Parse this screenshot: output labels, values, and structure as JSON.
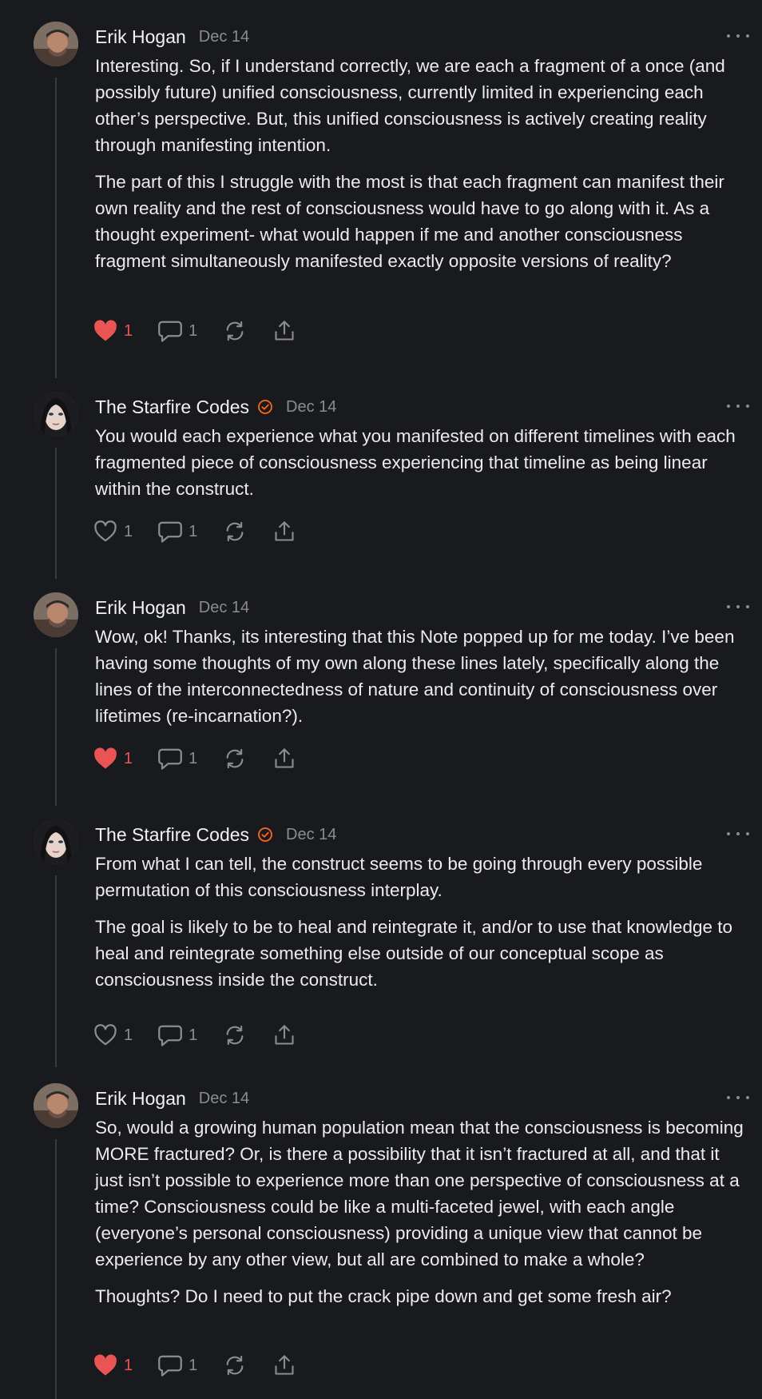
{
  "thread": {
    "notes": [
      {
        "author": "Erik Hogan",
        "date": "Dec 14",
        "verified": false,
        "paragraphs": [
          "Interesting. So, if I understand correctly, we are each a fragment of a once (and possibly future) unified consciousness, currently limited in experiencing each other’s perspective. But, this unified consciousness is actively creating reality through manifesting intention.",
          "The part of this I struggle with the most is that each fragment can manifest their own reality and the rest of consciousness would have to go along with it. As a thought experiment- what would happen if me and another consciousness fragment simultaneously manifested exactly opposite versions of reality?"
        ],
        "likes": "1",
        "liked": true,
        "comments": "1"
      },
      {
        "author": "The Starfire Codes",
        "date": "Dec 14",
        "verified": true,
        "paragraphs": [
          "You would each experience what you manifested on different timelines with each fragmented piece of consciousness experiencing that timeline as being linear within the construct."
        ],
        "likes": "1",
        "liked": false,
        "comments": "1"
      },
      {
        "author": "Erik Hogan",
        "date": "Dec 14",
        "verified": false,
        "paragraphs": [
          "Wow, ok! Thanks, its interesting that this Note popped up for me today. I’ve been having some thoughts of my own along these lines lately, specifically along the lines of the interconnectedness of nature and continuity of consciousness over lifetimes (re-incarnation?)."
        ],
        "likes": "1",
        "liked": true,
        "comments": "1"
      },
      {
        "author": "The Starfire Codes",
        "date": "Dec 14",
        "verified": true,
        "paragraphs": [
          "From what I can tell, the construct seems to be going through every possible permutation of this consciousness interplay.",
          "The goal is likely to be to heal and reintegrate it, and/or to use that knowledge to heal and reintegrate something else outside of our conceptual scope as consciousness inside the construct."
        ],
        "likes": "1",
        "liked": false,
        "comments": "1"
      },
      {
        "author": "Erik Hogan",
        "date": "Dec 14",
        "verified": false,
        "paragraphs": [
          "So, would a growing human population mean that the consciousness is becoming MORE fractured? Or, is there a possibility that it isn’t fractured at all, and that it just isn’t possible to experience more than one perspective of consciousness at a time? Consciousness could be like a multi-faceted jewel, with each angle (everyone’s personal consciousness) providing a unique view that cannot be experience by any other view, but all are combined to make a whole?",
          "Thoughts? Do I need to put the crack pipe down and get some fresh air?"
        ],
        "likes": "1",
        "liked": true,
        "comments": "1"
      }
    ]
  },
  "colors": {
    "background": "#191a1d",
    "text": "#ececee",
    "muted": "#8b8c91",
    "like_active": "#ea5455",
    "verified": "#ff6719"
  },
  "icons": {
    "like": "heart-icon",
    "comment": "speech-bubble-icon",
    "restack": "restack-icon",
    "share": "share-icon",
    "more": "ellipsis-icon",
    "verified": "verified-check-icon"
  }
}
